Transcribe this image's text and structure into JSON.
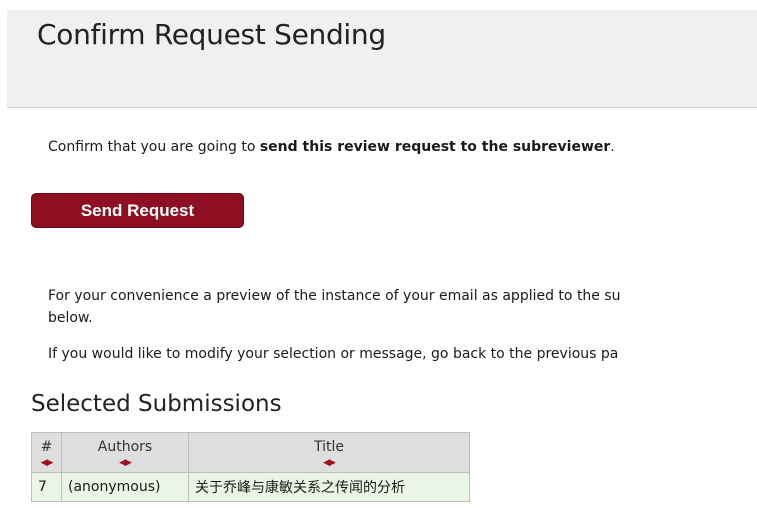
{
  "header": {
    "title": "Confirm Request Sending"
  },
  "confirm": {
    "prefix": "Confirm that you are going to ",
    "bold": "send this review request to the subreviewer",
    "suffix": "."
  },
  "buttons": {
    "send_label": "Send Request"
  },
  "info": {
    "preview_line1": "For your convenience a preview of the instance of your email as applied to the su",
    "preview_line2": "below.",
    "modify_line": "If you would like to modify your selection or message, go back to the previous pa"
  },
  "submissions": {
    "title": "Selected Submissions",
    "columns": [
      "#",
      "Authors",
      "Title"
    ],
    "sort_icon": "sort-arrows-icon",
    "rows": [
      {
        "num": "7",
        "authors": "(anonymous)",
        "title": "关于乔峰与康敏关系之传闻的分析"
      }
    ]
  },
  "colors": {
    "header_bg": "#f2f0ee",
    "button_bg": "#8e0e22",
    "table_header_bg": "#dedede",
    "table_row_bg": "#eaf5e6",
    "sort_arrow": "#a01020"
  }
}
